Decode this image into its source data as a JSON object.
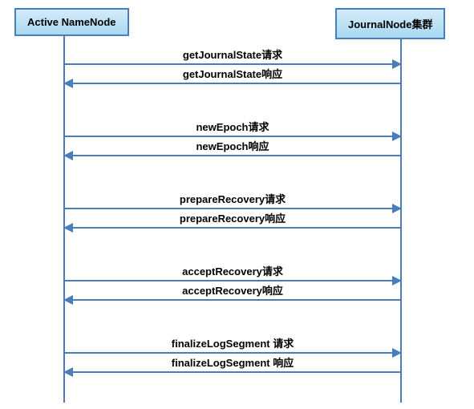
{
  "participants": {
    "left": "Active NameNode",
    "right": "JournalNode集群"
  },
  "messages": [
    {
      "label": "getJournalState请求",
      "dir": "right"
    },
    {
      "label": "getJournalState响应",
      "dir": "left"
    },
    {
      "label": "newEpoch请求",
      "dir": "right"
    },
    {
      "label": "newEpoch响应",
      "dir": "left"
    },
    {
      "label": "prepareRecovery请求",
      "dir": "right"
    },
    {
      "label": "prepareRecovery响应",
      "dir": "left"
    },
    {
      "label": "acceptRecovery请求",
      "dir": "right"
    },
    {
      "label": "acceptRecovery响应",
      "dir": "left"
    },
    {
      "label": "finalizeLogSegment 请求",
      "dir": "right"
    },
    {
      "label": "finalizeLogSegment 响应",
      "dir": "left"
    }
  ],
  "chart_data": {
    "type": "sequence_diagram",
    "participants": [
      "Active NameNode",
      "JournalNode集群"
    ],
    "interactions": [
      {
        "from": "Active NameNode",
        "to": "JournalNode集群",
        "message": "getJournalState请求"
      },
      {
        "from": "JournalNode集群",
        "to": "Active NameNode",
        "message": "getJournalState响应"
      },
      {
        "from": "Active NameNode",
        "to": "JournalNode集群",
        "message": "newEpoch请求"
      },
      {
        "from": "JournalNode集群",
        "to": "Active NameNode",
        "message": "newEpoch响应"
      },
      {
        "from": "Active NameNode",
        "to": "JournalNode集群",
        "message": "prepareRecovery请求"
      },
      {
        "from": "JournalNode集群",
        "to": "Active NameNode",
        "message": "prepareRecovery响应"
      },
      {
        "from": "Active NameNode",
        "to": "JournalNode集群",
        "message": "acceptRecovery请求"
      },
      {
        "from": "JournalNode集群",
        "to": "Active NameNode",
        "message": "acceptRecovery响应"
      },
      {
        "from": "Active NameNode",
        "to": "JournalNode集群",
        "message": "finalizeLogSegment 请求"
      },
      {
        "from": "JournalNode集群",
        "to": "Active NameNode",
        "message": "finalizeLogSegment 响应"
      }
    ]
  }
}
